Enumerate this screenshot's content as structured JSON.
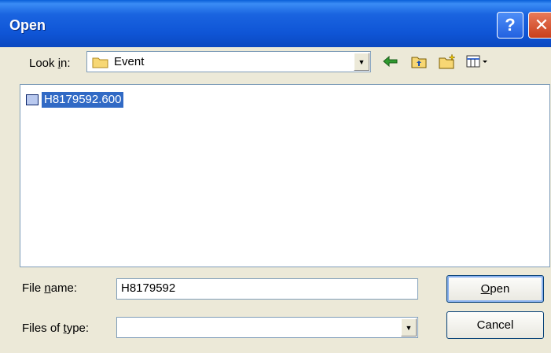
{
  "window": {
    "title": "Open",
    "help_btn": "?",
    "close_btn": "✕"
  },
  "lookin": {
    "label_pre": "Look ",
    "label_accel": "i",
    "label_post": "n:",
    "value": "Event"
  },
  "files": [
    {
      "name": "H8179592.600"
    }
  ],
  "filename": {
    "label_pre": "File ",
    "label_accel": "n",
    "label_post": "ame:",
    "value": "H8179592"
  },
  "filetype": {
    "label_pre": "Files of ",
    "label_accel": "t",
    "label_post": "ype:",
    "value": ""
  },
  "buttons": {
    "open_accel": "O",
    "open_rest": "pen",
    "cancel": "Cancel"
  }
}
